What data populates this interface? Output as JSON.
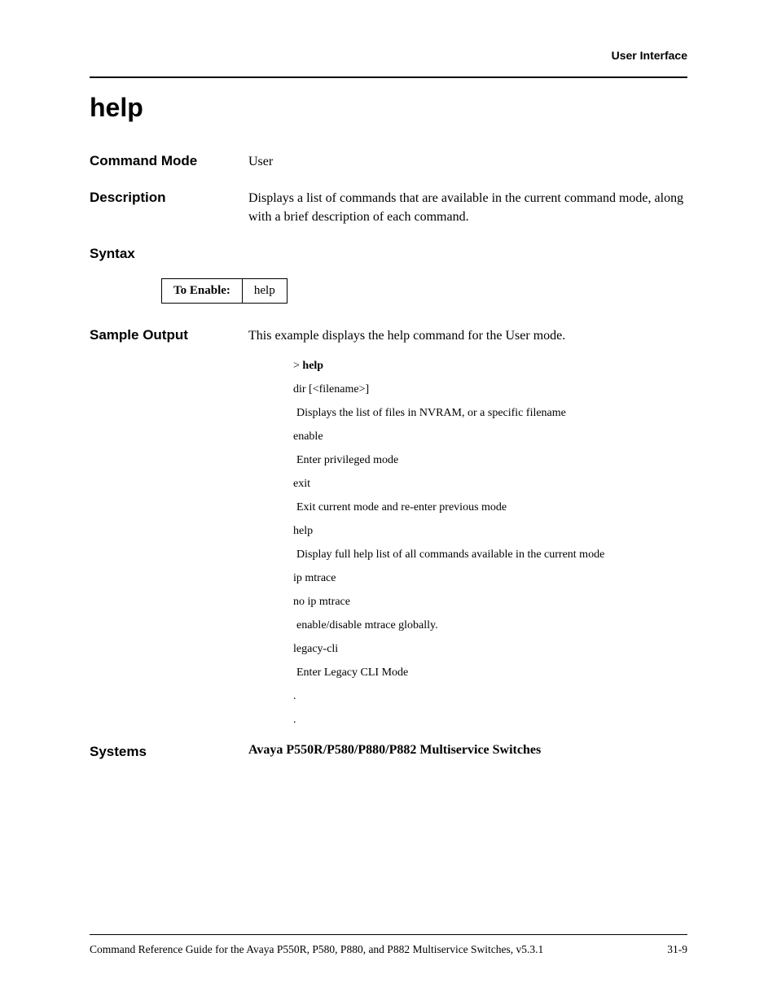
{
  "header": {
    "section_name": "User Interface"
  },
  "title": "help",
  "rows": {
    "command_mode": {
      "label": "Command Mode",
      "value": "User"
    },
    "description": {
      "label": "Description",
      "value": "Displays a list of commands that are available in the current command mode, along with a brief description of each command."
    },
    "syntax": {
      "label": "Syntax",
      "table_label": "To Enable:",
      "table_value": "help"
    },
    "sample_output": {
      "label": "Sample Output",
      "intro": "This example displays the help command for the User mode.",
      "prompt_prefix": "> ",
      "prompt_cmd": "help",
      "lines": [
        "dir [<filename>]",
        " Displays the list of files in NVRAM, or a specific filename",
        "enable",
        " Enter privileged mode",
        "exit",
        " Exit current mode and re-enter previous mode",
        "help",
        " Display full help list of all commands available in the current mode",
        "ip mtrace",
        "no ip mtrace",
        " enable/disable mtrace globally.",
        "legacy-cli",
        " Enter Legacy CLI Mode",
        ".",
        "."
      ]
    },
    "systems": {
      "label": "Systems",
      "value": "Avaya P550R/P580/P880/P882 Multiservice Switches"
    }
  },
  "footer": {
    "text": "Command Reference Guide for the Avaya P550R, P580, P880, and P882 Multiservice Switches, v5.3.1",
    "page": "31-9"
  }
}
